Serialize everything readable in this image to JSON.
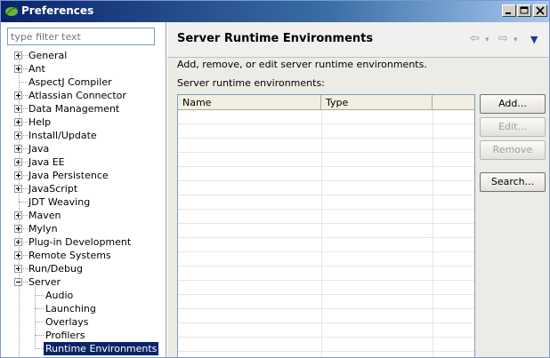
{
  "window": {
    "title": "Preferences"
  },
  "filter": {
    "placeholder": "type filter text"
  },
  "tree": [
    {
      "label": "General",
      "expandable": true,
      "expanded": false,
      "level": 0
    },
    {
      "label": "Ant",
      "expandable": true,
      "expanded": false,
      "level": 0
    },
    {
      "label": "AspectJ Compiler",
      "expandable": false,
      "level": 0
    },
    {
      "label": "Atlassian Connector",
      "expandable": true,
      "expanded": false,
      "level": 0
    },
    {
      "label": "Data Management",
      "expandable": true,
      "expanded": false,
      "level": 0
    },
    {
      "label": "Help",
      "expandable": true,
      "expanded": false,
      "level": 0
    },
    {
      "label": "Install/Update",
      "expandable": true,
      "expanded": false,
      "level": 0
    },
    {
      "label": "Java",
      "expandable": true,
      "expanded": false,
      "level": 0
    },
    {
      "label": "Java EE",
      "expandable": true,
      "expanded": false,
      "level": 0
    },
    {
      "label": "Java Persistence",
      "expandable": true,
      "expanded": false,
      "level": 0
    },
    {
      "label": "JavaScript",
      "expandable": true,
      "expanded": false,
      "level": 0
    },
    {
      "label": "JDT Weaving",
      "expandable": false,
      "level": 0
    },
    {
      "label": "Maven",
      "expandable": true,
      "expanded": false,
      "level": 0
    },
    {
      "label": "Mylyn",
      "expandable": true,
      "expanded": false,
      "level": 0
    },
    {
      "label": "Plug-in Development",
      "expandable": true,
      "expanded": false,
      "level": 0
    },
    {
      "label": "Remote Systems",
      "expandable": true,
      "expanded": false,
      "level": 0
    },
    {
      "label": "Run/Debug",
      "expandable": true,
      "expanded": false,
      "level": 0
    },
    {
      "label": "Server",
      "expandable": true,
      "expanded": true,
      "level": 0
    },
    {
      "label": "Audio",
      "expandable": false,
      "level": 1
    },
    {
      "label": "Launching",
      "expandable": false,
      "level": 1
    },
    {
      "label": "Overlays",
      "expandable": false,
      "level": 1
    },
    {
      "label": "Profilers",
      "expandable": false,
      "level": 1
    },
    {
      "label": "Runtime Environments",
      "expandable": false,
      "level": 1,
      "selected": true
    }
  ],
  "page": {
    "title": "Server Runtime Environments",
    "description": "Add, remove, or edit server runtime environments.",
    "envs_label": "Server runtime environments:",
    "back_icon": "back-arrow-icon",
    "forward_icon": "forward-arrow-icon",
    "menu_icon": "view-menu-icon"
  },
  "table": {
    "columns": [
      "Name",
      "Type",
      ""
    ],
    "rows": []
  },
  "buttons": {
    "add": "Add...",
    "edit": "Edit...",
    "remove": "Remove",
    "search": "Search..."
  },
  "colors": {
    "title_bar": "#0a246a",
    "selection": "#0a246a"
  }
}
